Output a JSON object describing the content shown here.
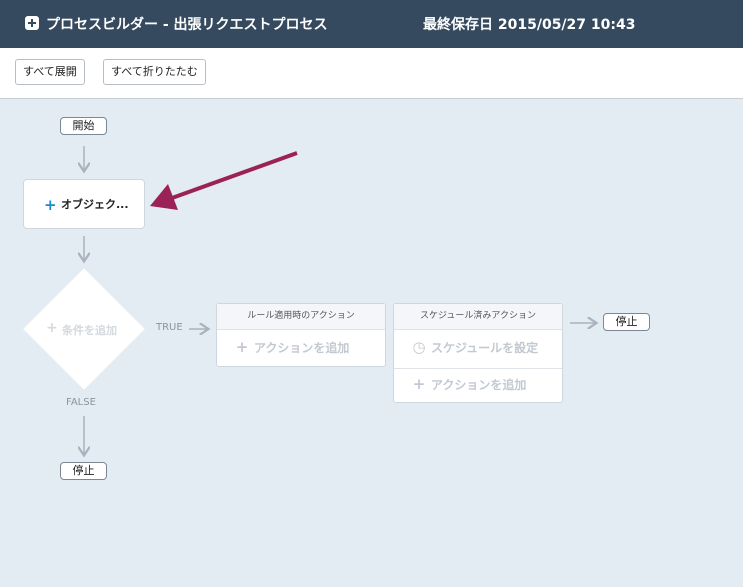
{
  "header": {
    "title": "プロセスビルダー - 出張リクエストプロセス",
    "saved_at": "最終保存日 2015/05/27 10:43"
  },
  "toolbar": {
    "expand_all": "すべて展開",
    "collapse_all": "すべて折りたたむ"
  },
  "flow": {
    "start": "開始",
    "object_node": "オブジェク...",
    "condition": "条件を追加",
    "true_label": "TRUE",
    "false_label": "FALSE",
    "stop_bottom": "停止",
    "stop_right": "停止",
    "immediate_actions": {
      "header": "ルール適用時のアクション",
      "add_action": "アクションを追加"
    },
    "scheduled_actions": {
      "header": "スケジュール済みアクション",
      "set_schedule": "スケジュールを設定",
      "add_action": "アクションを追加"
    }
  },
  "colors": {
    "header_bg": "#354a5f",
    "canvas_bg": "#e3ebf3",
    "accent_blue": "#1a8ad1",
    "annotation_arrow": "#9b2257"
  }
}
